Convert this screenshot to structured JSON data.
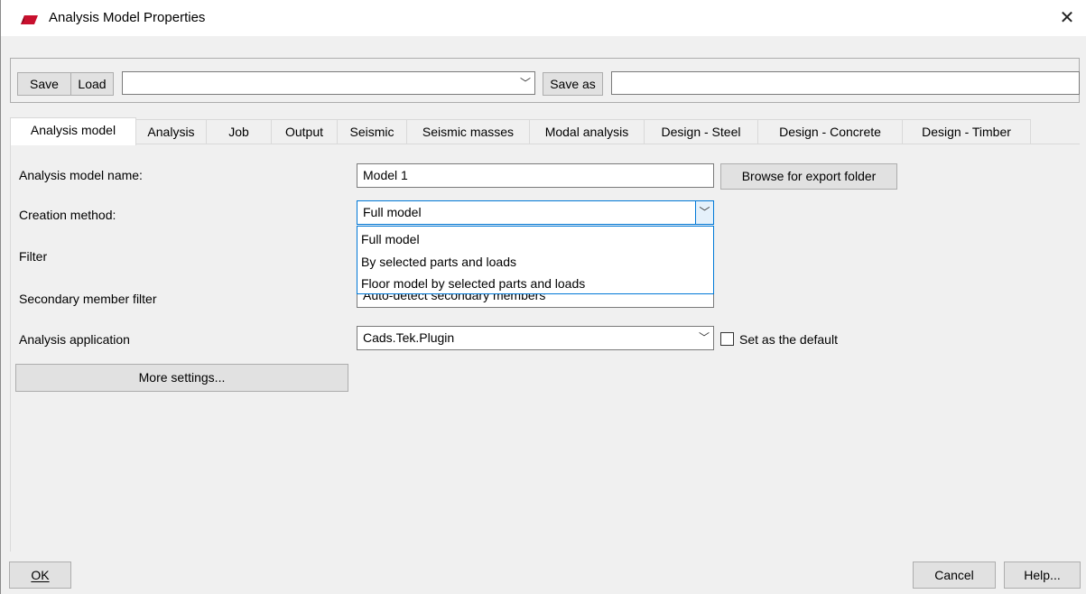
{
  "window": {
    "title": "Analysis Model Properties",
    "close_glyph": "✕",
    "app_icon": "tekla-logo-icon",
    "accent_color": "#0078d7",
    "icon_color": "#c8102e"
  },
  "toolbar": {
    "save_label": "Save",
    "load_label": "Load",
    "preset_value": "",
    "save_as_label": "Save as",
    "save_as_value": ""
  },
  "tabs": [
    {
      "label": "Analysis model",
      "active": true
    },
    {
      "label": "Analysis"
    },
    {
      "label": "Job"
    },
    {
      "label": "Output"
    },
    {
      "label": "Seismic"
    },
    {
      "label": "Seismic masses"
    },
    {
      "label": "Modal analysis"
    },
    {
      "label": "Design - Steel"
    },
    {
      "label": "Design - Concrete"
    },
    {
      "label": "Design - Timber"
    }
  ],
  "form": {
    "name_label": "Analysis model name:",
    "name_value": "Model 1",
    "browse_label": "Browse for export folder",
    "creation_label": "Creation method:",
    "creation_value": "Full model",
    "filter_label": "Filter",
    "secondary_label": "Secondary member filter",
    "secondary_value": "Auto-detect secondary members",
    "application_label": "Analysis application",
    "application_value": "Cads.Tek.Plugin",
    "default_label": "Set as the default",
    "default_checked": false,
    "more_settings_label": "More settings..."
  },
  "dropdown": {
    "options": [
      "Full model",
      "By selected parts and loads",
      "Floor model by selected parts and loads"
    ]
  },
  "footer": {
    "ok_label": "OK",
    "cancel_label": "Cancel",
    "help_label": "Help..."
  }
}
